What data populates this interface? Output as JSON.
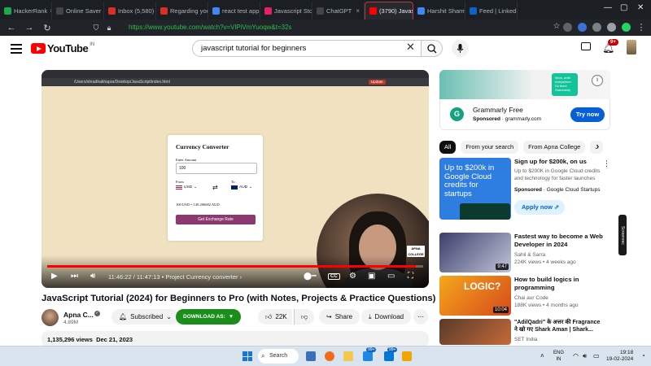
{
  "browser": {
    "tabs": [
      {
        "label": "HackerRank",
        "color": "#1ba94c"
      },
      {
        "label": "Online Saver",
        "color": "#444"
      },
      {
        "label": "Inbox (5,580)",
        "color": "#d93025"
      },
      {
        "label": "Regarding you",
        "color": "#d93025"
      },
      {
        "label": "react test app",
        "color": "#4285f4"
      },
      {
        "label": "Javascript Sto",
        "color": "#e91e63"
      },
      {
        "label": "ChatGPT",
        "color": "#444"
      },
      {
        "label": "(3790) Javas",
        "color": "#ff0000",
        "active": true
      },
      {
        "label": "Harshit Sharma",
        "color": "#4285f4"
      },
      {
        "label": "Feed | LinkedIn",
        "color": "#0a66c2"
      }
    ],
    "url": "https://www.youtube.com/watch?v=VlPiVmYuoqw&t=32s"
  },
  "header": {
    "logo_text": "YouTube",
    "country": "IN",
    "search_value": "javascript tutorial for beginners",
    "notification_count": "9+"
  },
  "player": {
    "inner_url": "/Users/shradhakhapra/Desktop/JavaScript/index.html",
    "inner_update": "Update",
    "time": "11:46:22 / 11:47:13",
    "chapter": "• Project Currency converter",
    "progress": 0.98,
    "app": {
      "title": "Currency Converter",
      "amount_label": "Enter Amount",
      "amount": "100",
      "from_label": "From",
      "to_label": "To",
      "from": "USD",
      "to": "AUD",
      "result": "100 USD = 149.206682 AUD",
      "button": "Get Exchange Rate"
    },
    "brand": "APNA COLLEGE",
    "cc_label": "CC"
  },
  "video": {
    "title": "JavaScript Tutorial (2024) for Beginners to Pro (with Notes, Projects & Practice Questions)",
    "channel": "Apna C...",
    "subscribers": "4.89M",
    "subscribed_label": "Subscribed",
    "download_as_label": "DOWNLOAD AS:",
    "likes": "22K",
    "share_label": "Share",
    "download_label": "Download",
    "views": "1,135,296 views",
    "date": "Dec 21, 2023"
  },
  "ad": {
    "banner_text": "Work, write everywhere. Go there Grammarly",
    "name": "Grammarly Free",
    "sponsored": "Sponsored",
    "domain": "grammarly.com",
    "cta": "Try now"
  },
  "chips": [
    "All",
    "From your search",
    "From Apna College",
    "J"
  ],
  "recommendations": [
    {
      "title": "Sign up for $200k, on us",
      "subtitle": "Up to $200K in Google Cloud credits and technology for faster launches",
      "sponsored": "Sponsored",
      "channel": "Google Cloud Startups",
      "thumb_text": "Up to $200k in Google Cloud credits for startups",
      "cta": "Apply now"
    },
    {
      "title": "Fastest way to become a Web Developer in 2024",
      "channel": "Sahil & Sarra",
      "meta": "224K views • 4 weeks ago",
      "duration": "9:47"
    },
    {
      "title": "How to build logics in programming",
      "channel": "Chai aur Code",
      "meta": "188K views • 4 months ago",
      "duration": "10:04",
      "thumb_text": "LOGIC?"
    },
    {
      "title": "\"AdilQadri\" के अत्तर की Fragrance ने खो गए Shark Aman | Shark...",
      "channel": "SET India",
      "meta": ""
    }
  ],
  "screen_recorder": "Screenrec",
  "taskbar": {
    "search": "Search",
    "lang": "ENG",
    "region": "IN",
    "time": "19:18",
    "date": "19-02-2024",
    "badge1": "99+",
    "badge2": "99+"
  }
}
